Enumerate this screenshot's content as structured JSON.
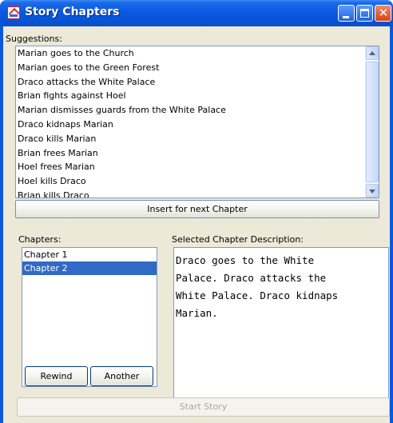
{
  "window": {
    "title": "Story Chapters"
  },
  "suggestions": {
    "label": "Suggestions:",
    "items": [
      "Marian goes to the Church",
      "Marian goes to the Green Forest",
      "Draco attacks the White Palace",
      "Brian fights against Hoel",
      "Marian dismisses guards from the White Palace",
      "Draco kidnaps Marian",
      "Draco kills Marian",
      "Brian frees Marian",
      "Hoel frees Marian",
      "Hoel kills Draco",
      "Brian kills Draco"
    ]
  },
  "buttons": {
    "insert": "Insert for next Chapter",
    "rewind": "Rewind",
    "another": "Another",
    "start": "Start Story"
  },
  "chapters": {
    "label": "Chapters:",
    "items": [
      "Chapter 1",
      "Chapter 2"
    ],
    "selected_index": 1
  },
  "description": {
    "label": "Selected Chapter Description:",
    "lines": [
      "Draco goes to the White",
      "Palace. Draco attacks the",
      "White Palace. Draco kidnaps",
      "Marian."
    ]
  },
  "colors": {
    "titlebar": "#0a5ae0",
    "selection": "#316ac5",
    "window_bg": "#ece9d8",
    "disabled_text": "#aca899"
  }
}
